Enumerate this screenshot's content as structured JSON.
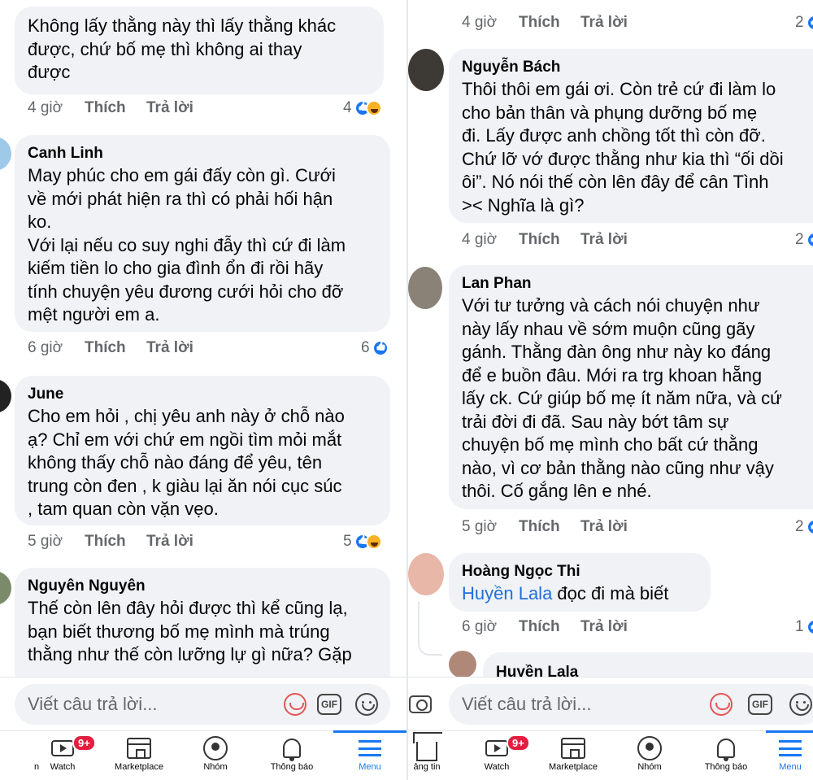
{
  "left": {
    "comments": [
      {
        "author": "",
        "text": "Không lấy thằng này thì lấy thằng khác\nđược, chứ bố mẹ thì không ai thay\nđược",
        "time": "4 giờ",
        "like": "Thích",
        "reply": "Trả lời",
        "reactions": "4"
      },
      {
        "author": "Canh Linh",
        "text": "May phúc cho em gái đấy còn gì. Cưới\nvề mới phát hiện ra thì có phải hối hận\nko.\nVới lại nếu co suy nghi đẫy thì cứ đi làm\nkiếm tiền lo cho gia đình ổn đi rồi hãy\ntính chuyện yêu đương cưới hỏi cho đỡ\nmệt người em a.",
        "time": "6 giờ",
        "like": "Thích",
        "reply": "Trả lời",
        "reactions": "6"
      },
      {
        "author": "June",
        "text": "Cho em hỏi , chị yêu anh này ở chỗ nào\nạ? Chỉ em với chứ em ngồi tìm mỏi mắt\nkhông thấy chỗ nào đáng để yêu, tên\ntrung còn đen , k giàu lại ăn nói cục súc\n, tam quan còn vặn vẹo.",
        "time": "5 giờ",
        "like": "Thích",
        "reply": "Trả lời",
        "reactions": "5"
      },
      {
        "author": "Nguyên Nguyên",
        "text": "Thế còn lên đây hỏi được thì kể cũng lạ,\nbạn biết thương bố mẹ mình mà trúng\nthằng như thế còn lưỡng lự gì nữa? Gặp"
      }
    ],
    "composer_placeholder": "Viết câu trả lời...",
    "tabs": [
      "n",
      "Watch",
      "Marketplace",
      "Nhóm",
      "Thông báo",
      "Menu"
    ],
    "badge": "9+"
  },
  "right": {
    "comments": [
      {
        "author": "",
        "text": "",
        "time": "4 giờ",
        "like": "Thích",
        "reply": "Trả lời",
        "reactions": "2"
      },
      {
        "author": "Nguyễn Bách",
        "text": "Thôi thôi em gái ơi. Còn trẻ cứ đi làm lo\ncho bản thân và phụng dưỡng bố mẹ\nđi. Lấy được anh chồng tốt thì còn đỡ.\nChứ lỡ vớ được thằng như kia thì “ối dồi\nôi”. Nó nói thế còn lên đây để cân Tình\n>< Nghĩa là gì?",
        "time": "4 giờ",
        "like": "Thích",
        "reply": "Trả lời",
        "reactions": "2"
      },
      {
        "author": "Lan Phan",
        "text": "Với tư tưởng và cách nói chuyện như\nnày lấy nhau về sớm muộn cũng gãy\ngánh. Thằng đàn ông như này ko đáng\nđể e buồn đâu. Mới ra trg khoan hẵng\nlấy ck. Cứ giúp bố mẹ ít năm nữa, và cứ\ntrải đời đi đã. Sau này bớt tâm sự\nchuyện bố mẹ mình cho bất cứ thằng\nnào, vì cơ bản thằng nào cũng như vậy\nthôi. Cố gắng lên e nhé.",
        "time": "5 giờ",
        "like": "Thích",
        "reply": "Trả lời",
        "reactions": "2"
      },
      {
        "author": "Hoàng Ngọc Thi",
        "mention": "Huyền Lala",
        "text": " đọc đi mà biết",
        "time": "6 giờ",
        "like": "Thích",
        "reply": "Trả lời",
        "reactions": "1"
      },
      {
        "author": "Huyền Lala",
        "text": ""
      }
    ],
    "composer_placeholder": "Viết câu trả lời...",
    "tabs": [
      "ảng tin",
      "Watch",
      "Marketplace",
      "Nhóm",
      "Thông báo",
      "Menu"
    ],
    "badge": "9+"
  },
  "colors": {
    "bubble": "#f0f2f5",
    "link": "#216fdb",
    "accent": "#1877f2",
    "badge": "#e41e3f"
  }
}
